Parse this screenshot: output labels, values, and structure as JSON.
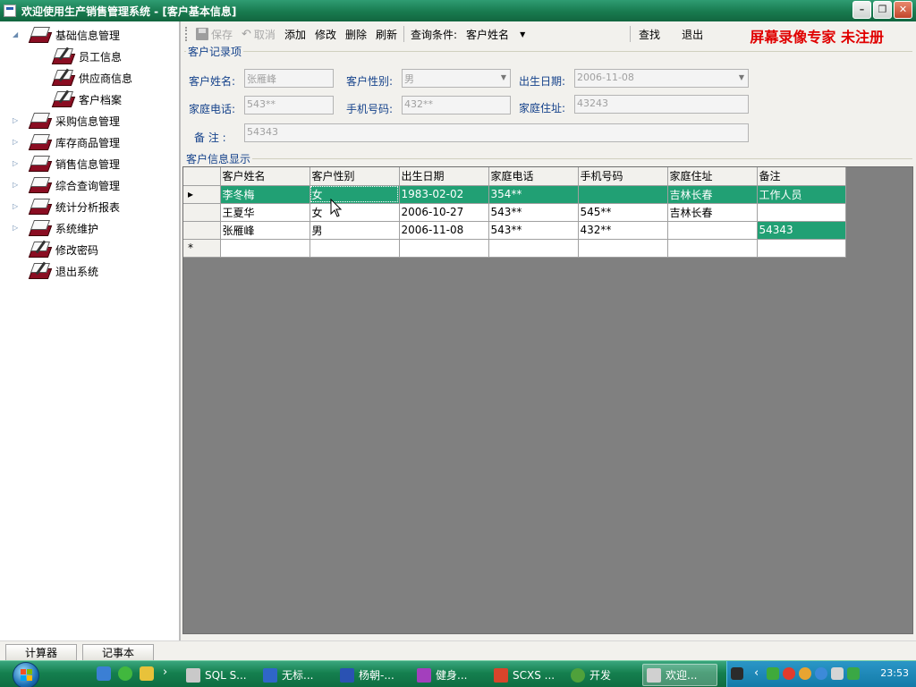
{
  "window": {
    "title": "欢迎使用生产销售管理系统 - [客户基本信息]",
    "controls": [
      "minimize",
      "restore",
      "close"
    ]
  },
  "watermark": "屏幕录像专家  未注册",
  "tree": [
    {
      "label": "基础信息管理",
      "expanded": true,
      "icon": "book-icon"
    },
    {
      "label": "员工信息",
      "icon": "book-pen-icon"
    },
    {
      "label": "供应商信息",
      "icon": "book-pen-icon"
    },
    {
      "label": "客户档案",
      "icon": "book-pen-icon"
    },
    {
      "label": "采购信息管理",
      "icon": "book-icon"
    },
    {
      "label": "库存商品管理",
      "icon": "book-icon"
    },
    {
      "label": "销售信息管理",
      "icon": "book-icon"
    },
    {
      "label": "综合查询管理",
      "icon": "book-icon"
    },
    {
      "label": "统计分析报表",
      "icon": "book-icon"
    },
    {
      "label": "系统维护",
      "icon": "book-icon"
    },
    {
      "label": "修改密码",
      "icon": "book-pen-icon"
    },
    {
      "label": "退出系统",
      "icon": "book-pen-icon"
    }
  ],
  "toolbar": {
    "save": "保存",
    "cancel": "取消",
    "add": "添加",
    "edit": "修改",
    "delete": "删除",
    "refresh": "刷新",
    "query_label": "查询条件:",
    "query_value": "客户姓名",
    "find": "查找",
    "exit": "退出"
  },
  "form": {
    "group_title": "客户记录项",
    "name_label": "客户姓名:",
    "name_value": "张雁峰",
    "gender_label": "客户性别:",
    "gender_value": "男",
    "birth_label": "出生日期:",
    "birth_value": "2006-11-08",
    "home_phone_label": "家庭电话:",
    "home_phone_value": "543**",
    "mobile_label": "手机号码:",
    "mobile_value": "432**",
    "address_label": "家庭住址:",
    "address_value": "43243",
    "remark_label": "备 注 :",
    "remark_value": "54343"
  },
  "grid": {
    "title": "客户信息显示",
    "columns": [
      "客户姓名",
      "客户性别",
      "出生日期",
      "家庭电话",
      "手机号码",
      "家庭住址",
      "备注"
    ],
    "rows": [
      [
        "李冬梅",
        "女",
        "1983-02-02",
        "354**",
        "",
        "吉林长春",
        "工作人员"
      ],
      [
        "王夏华",
        "女",
        "2006-10-27",
        "543**",
        "545**",
        "吉林长春",
        ""
      ],
      [
        "张雁峰",
        "男",
        "2006-11-08",
        "543**",
        "432**",
        "",
        "54343"
      ]
    ],
    "current_row_marker": "▸",
    "new_row_marker": "*"
  },
  "bottom_tabs": [
    "计算器",
    "记事本"
  ],
  "taskbar": {
    "tasks": [
      "SQL S...",
      "无标...",
      "杨朝-...",
      "健身...",
      "SCXS ...",
      "开发",
      "欢迎..."
    ],
    "clock": "23:53"
  },
  "colors": {
    "title_bar": "#187a4f",
    "selection": "#21a074",
    "label_text": "#15428b",
    "watermark": "#e00000",
    "grid_background": "#808080"
  }
}
